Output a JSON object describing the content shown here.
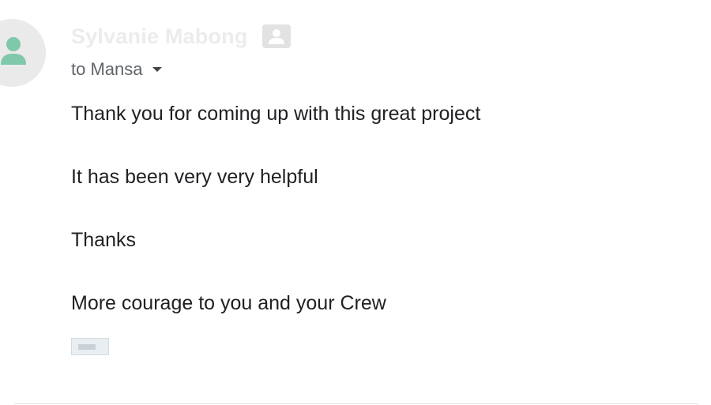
{
  "sender": {
    "name": "Sylvanie Mabong",
    "avatar_icon": "person-icon",
    "avatar_icon_color": "#7fc8a9",
    "contact_icon": "contact-card-icon"
  },
  "recipient": {
    "label": "to Mansa",
    "expand_icon": "chevron-down-icon"
  },
  "body": {
    "lines": [
      "Thank you for coming up with this great project",
      "It has been very very helpful",
      "Thanks",
      "More courage to you and your Crew"
    ]
  },
  "attachment": {
    "icon": "image-thumbnail-icon"
  }
}
